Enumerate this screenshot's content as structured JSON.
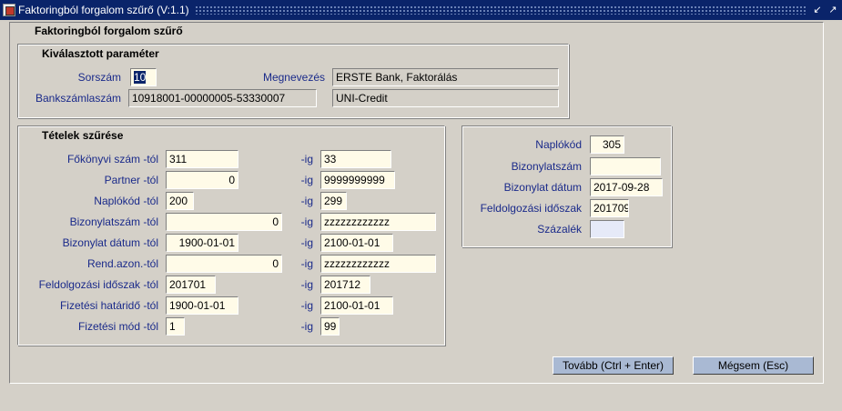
{
  "window": {
    "title": "Faktoringból forgalom szűrő (V:1.1)"
  },
  "form": {
    "heading": "Faktoringból forgalom szűrő"
  },
  "selected_params": {
    "heading": "Kiválasztott paraméter",
    "sorszam_label": "Sorszám",
    "sorszam_value": "10",
    "megnevezes_label": "Megnevezés",
    "megnevezes_value": "ERSTE Bank, Faktorálás",
    "bankszamla_label": "Bankszámlaszám",
    "bankszamla_value": "10918001-00000005-53330007",
    "bank_name_value": "UNI-Credit"
  },
  "filter": {
    "heading": "Tételek szűrése",
    "ig_label": "-ig",
    "rows": [
      {
        "label": "Főkönyvi szám -tól",
        "from": "311",
        "to": "33"
      },
      {
        "label": "Partner -tól",
        "from": "0",
        "to": "9999999999"
      },
      {
        "label": "Naplókód -tól",
        "from": "200",
        "to": "299"
      },
      {
        "label": "Bizonylatszám -tól",
        "from": "0",
        "to": "zzzzzzzzzzzz"
      },
      {
        "label": "Bizonylat dátum -tól",
        "from": "1900-01-01",
        "to": "2100-01-01"
      },
      {
        "label": "Rend.azon.-tól",
        "from": "0",
        "to": "zzzzzzzzzzzz"
      },
      {
        "label": "Feldolgozási időszak -tól",
        "from": "201701",
        "to": "201712"
      },
      {
        "label": "Fizetési határidő -tól",
        "from": "1900-01-01",
        "to": "2100-01-01"
      },
      {
        "label": "Fizetési mód -tól",
        "from": "1",
        "to": "99"
      }
    ]
  },
  "right_panel": {
    "naplokod_label": "Naplókód",
    "naplokod_value": "305",
    "bizonylatszam_label": "Bizonylatszám",
    "bizonylatszam_value": "",
    "bizonylat_datum_label": "Bizonylat dátum",
    "bizonylat_datum_value": "2017-09-28",
    "feldolgozasi_label": "Feldolgozási időszak",
    "feldolgozasi_value": "201709",
    "szazalek_label": "Százalék",
    "szazalek_value": ""
  },
  "buttons": {
    "next_label": "Tovább (Ctrl + Enter)",
    "cancel_label": "Mégsem (Esc)"
  },
  "colors": {
    "titlebar": "#0a246a",
    "field_bg": "#fffbe8",
    "label_text": "#1a2a8a",
    "button_bg": "#a9b9d3"
  }
}
